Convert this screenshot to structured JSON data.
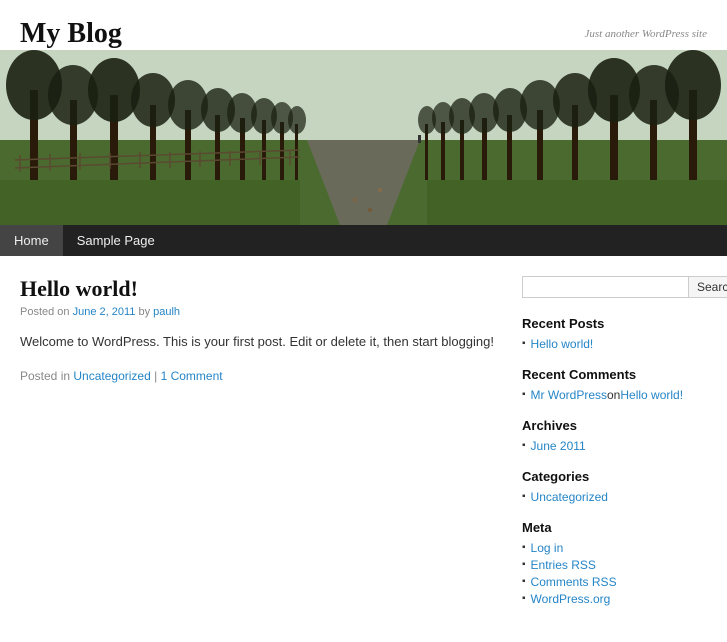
{
  "header": {
    "title": "My Blog",
    "tagline": "Just another WordPress site"
  },
  "nav": {
    "items": [
      {
        "label": "Home",
        "active": true
      },
      {
        "label": "Sample Page",
        "active": false
      }
    ]
  },
  "post": {
    "title": "Hello world!",
    "meta_prefix": "Posted on ",
    "date": "June 2, 2011",
    "author_prefix": " by ",
    "author": "paulh",
    "content": "Welcome to WordPress. This is your first post. Edit or delete it, then start blogging!",
    "footer_prefix": "Posted in ",
    "category": "Uncategorized",
    "separator": " | ",
    "comment_link": "1 Comment"
  },
  "sidebar": {
    "search_placeholder": "",
    "search_button": "Search",
    "sections": [
      {
        "heading": "Recent Posts",
        "items": [
          {
            "text": "Hello world!",
            "link": true
          }
        ]
      },
      {
        "heading": "Recent Comments",
        "items": [
          {
            "text": "Mr WordPress",
            "link": true,
            "suffix": " on ",
            "suffix_link": "Hello world!"
          }
        ]
      },
      {
        "heading": "Archives",
        "items": [
          {
            "text": "June 2011",
            "link": true
          }
        ]
      },
      {
        "heading": "Categories",
        "items": [
          {
            "text": "Uncategorized",
            "link": true
          }
        ]
      },
      {
        "heading": "Meta",
        "items": [
          {
            "text": "Log in",
            "link": true
          },
          {
            "text": "Entries RSS",
            "link": true
          },
          {
            "text": "Comments RSS",
            "link": true
          },
          {
            "text": "WordPress.org",
            "link": true
          }
        ]
      }
    ]
  }
}
